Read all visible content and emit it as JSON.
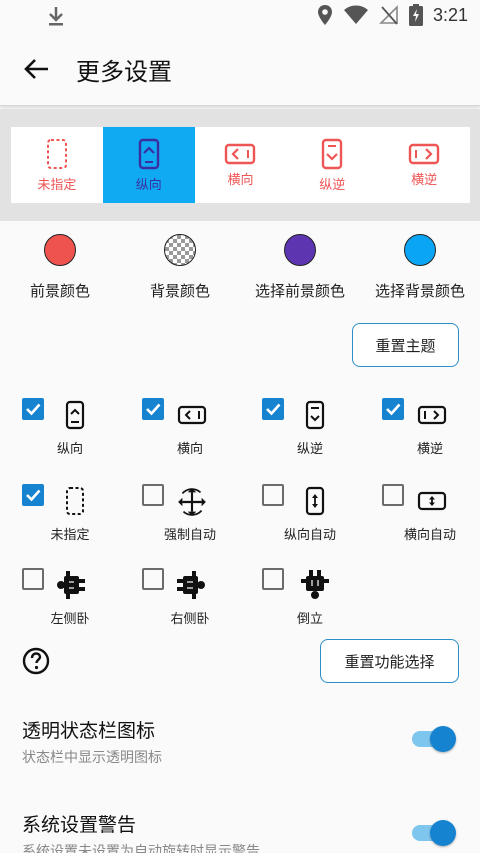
{
  "status_bar": {
    "time": "3:21",
    "icons": [
      "download-icon",
      "location-icon",
      "wifi-icon",
      "no-sim-icon",
      "battery-icon"
    ]
  },
  "header": {
    "title": "更多设置",
    "back_icon": "arrow-left-icon"
  },
  "orientation_selector": {
    "items": [
      {
        "label": "未指定",
        "icon": "unspecified-icon",
        "selected": false
      },
      {
        "label": "纵向",
        "icon": "portrait-icon",
        "selected": true
      },
      {
        "label": "横向",
        "icon": "landscape-icon",
        "selected": false
      },
      {
        "label": "纵逆",
        "icon": "reverse-portrait-icon",
        "selected": false
      },
      {
        "label": "横逆",
        "icon": "reverse-landscape-icon",
        "selected": false
      }
    ],
    "accent_color": "#10aaf3",
    "label_color": "#e55555"
  },
  "theme_colors": {
    "items": [
      {
        "label": "前景颜色",
        "color": "#ef5350"
      },
      {
        "label": "背景颜色",
        "color": "checkerboard"
      },
      {
        "label": "选择前景颜色",
        "color": "#5e35b1"
      },
      {
        "label": "选择背景颜色",
        "color": "#0aa6f5"
      }
    ],
    "reset_button": "重置主题"
  },
  "function_options": {
    "items": [
      {
        "label": "纵向",
        "icon": "portrait-icon",
        "checked": true
      },
      {
        "label": "横向",
        "icon": "landscape-icon",
        "checked": true
      },
      {
        "label": "纵逆",
        "icon": "reverse-portrait-icon",
        "checked": true
      },
      {
        "label": "横逆",
        "icon": "reverse-landscape-icon",
        "checked": true
      },
      {
        "label": "未指定",
        "icon": "unspecified-icon",
        "checked": true
      },
      {
        "label": "强制自动",
        "icon": "force-auto-icon",
        "checked": false
      },
      {
        "label": "纵向自动",
        "icon": "portrait-auto-icon",
        "checked": false
      },
      {
        "label": "横向自动",
        "icon": "landscape-auto-icon",
        "checked": false
      },
      {
        "label": "左侧卧",
        "icon": "lie-left-icon",
        "checked": false
      },
      {
        "label": "右侧卧",
        "icon": "lie-right-icon",
        "checked": false
      },
      {
        "label": "倒立",
        "icon": "upside-down-icon",
        "checked": false
      }
    ],
    "reset_button": "重置功能选择",
    "help_icon": "help-icon"
  },
  "preferences": [
    {
      "title": "透明状态栏图标",
      "subtitle": "状态栏中显示透明图标",
      "enabled": true
    },
    {
      "title": "系统设置警告",
      "subtitle": "系统设置未设置为自动旋转时显示警告",
      "enabled": true
    }
  ]
}
